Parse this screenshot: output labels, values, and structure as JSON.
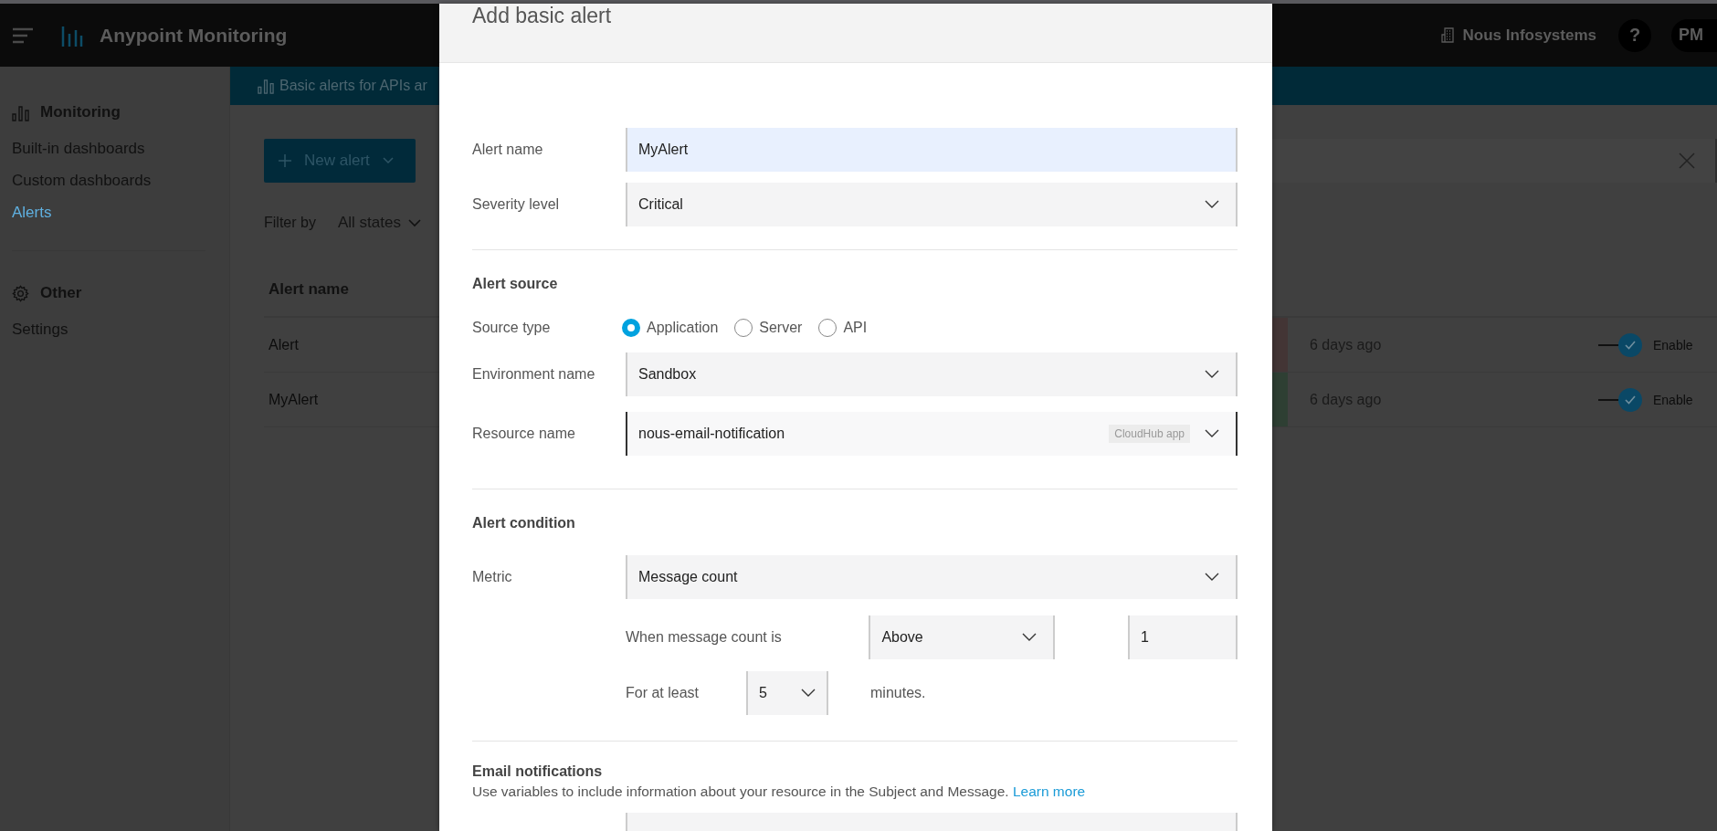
{
  "header": {
    "app_title": "Anypoint Monitoring",
    "org_name": "Nous Infosystems",
    "help_label": "?",
    "avatar_initials": "PM"
  },
  "sidebar": {
    "sections": [
      {
        "kind": "monitoring",
        "title": "Monitoring",
        "items": [
          {
            "label": "Built-in dashboards",
            "selected": false
          },
          {
            "label": "Custom dashboards",
            "selected": false
          },
          {
            "label": "Alerts",
            "selected": true
          }
        ]
      },
      {
        "kind": "settings",
        "title": "Other",
        "items": [
          {
            "label": "Settings",
            "selected": false
          }
        ]
      }
    ]
  },
  "banner": {
    "text": "Basic alerts for APIs ar"
  },
  "toolbar": {
    "new_alert_label": "New alert"
  },
  "filter": {
    "label": "Filter by",
    "value": "All states"
  },
  "table": {
    "columns": [
      "Alert name"
    ],
    "rows": [
      {
        "name": "Alert",
        "color": "#433535",
        "time": "6 days ago",
        "enabled": true,
        "status": "Enable"
      },
      {
        "name": "MyAlert",
        "color": "#2e3f33",
        "time": "6 days ago",
        "enabled": true,
        "status": "Enable"
      }
    ]
  },
  "dialog": {
    "title": "Add basic alert",
    "alert_name": {
      "label": "Alert name",
      "value": "MyAlert"
    },
    "severity": {
      "label": "Severity level",
      "value": "Critical"
    },
    "source_heading": "Alert source",
    "source_type": {
      "label": "Source type",
      "options": [
        {
          "label": "Application",
          "selected": true
        },
        {
          "label": "Server",
          "selected": false
        },
        {
          "label": "API",
          "selected": false
        }
      ]
    },
    "environment": {
      "label": "Environment name",
      "value": "Sandbox"
    },
    "resource": {
      "label": "Resource name",
      "value": "nous-email-notification",
      "tag": "CloudHub app"
    },
    "condition_heading": "Alert condition",
    "metric": {
      "label": "Metric",
      "value": "Message count"
    },
    "comparison": {
      "label": "When message count is",
      "operator": "Above",
      "threshold": "1"
    },
    "duration": {
      "label": "For at least",
      "value": "5",
      "unit": "minutes."
    },
    "email": {
      "heading": "Email notifications",
      "description": "Use variables to include information about your resource in the Subject and Message.",
      "link": "Learn more"
    }
  }
}
